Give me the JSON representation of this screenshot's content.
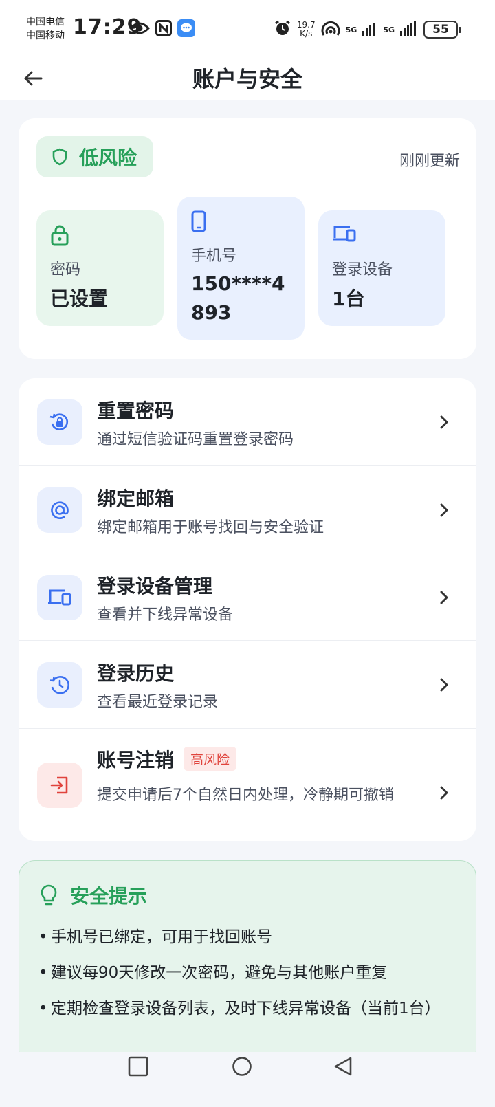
{
  "status_bar": {
    "carrier_1": "中国电信",
    "carrier_2": "中国移动",
    "time": "17:29",
    "net_speed_value": "19.7",
    "net_speed_unit": "K/s",
    "sig1": "5G",
    "sig2": "5G",
    "battery": "55"
  },
  "nav": {
    "title": "账户与安全"
  },
  "overview": {
    "risk_label": "低风险",
    "updated_text": "刚刚更新",
    "password_label": "密码",
    "password_value": "已设置",
    "phone_label": "手机号",
    "phone_value": "150****4893",
    "device_label": "登录设备",
    "device_value": "1台"
  },
  "menu": {
    "items": [
      {
        "title": "重置密码",
        "desc": "通过短信验证码重置登录密码"
      },
      {
        "title": "绑定邮箱",
        "desc": "绑定邮箱用于账号找回与安全验证"
      },
      {
        "title": "登录设备管理",
        "desc": "查看并下线异常设备"
      },
      {
        "title": "登录历史",
        "desc": "查看最近登录记录"
      },
      {
        "title": "账号注销",
        "badge": "高风险",
        "desc": "提交申请后7个自然日内处理，冷静期可撤销"
      }
    ]
  },
  "tips": {
    "title": "安全提示",
    "items": [
      "手机号已绑定，可用于找回账号",
      "建议每90天修改一次密码，避免与其他账户重复",
      "定期检查登录设备列表，及时下线异常设备（当前1台）"
    ]
  },
  "colors": {
    "green": "#27a05a",
    "blue": "#3a6ff0",
    "red": "#e0433c"
  }
}
